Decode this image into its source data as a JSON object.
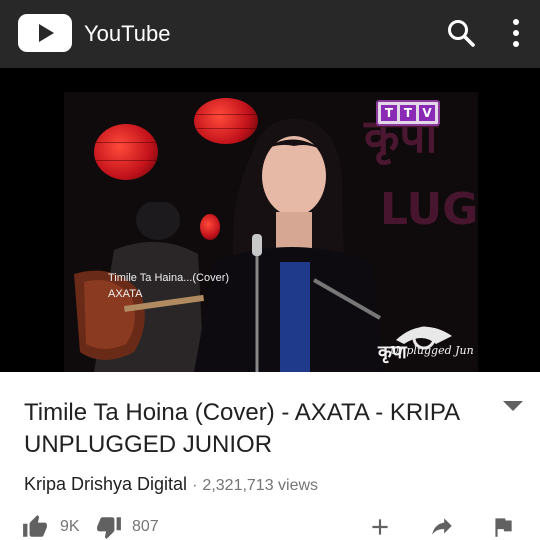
{
  "appbar": {
    "title": "YouTube",
    "icons": [
      "youtube-play-logo",
      "search-icon",
      "more-vert-icon"
    ]
  },
  "player": {
    "badge": [
      "T",
      "T",
      "V"
    ],
    "caption_title": "Timile Ta Haina...(Cover)",
    "caption_artist": "AXATA",
    "overlay_logo_text": "Unplugged Jun"
  },
  "video": {
    "title": "Timile Ta Hoina (Cover) - AXATA - KRIPA UNPLUGGED JUNIOR",
    "channel": "Kripa Drishya Digital",
    "separator": "·",
    "views": "2,321,713 views"
  },
  "actions": {
    "likes": "9K",
    "dislikes": "807"
  },
  "colors": {
    "appbar_bg": "#282828",
    "text_primary": "#212121",
    "text_secondary": "#757575",
    "icon_gray": "#616161"
  }
}
